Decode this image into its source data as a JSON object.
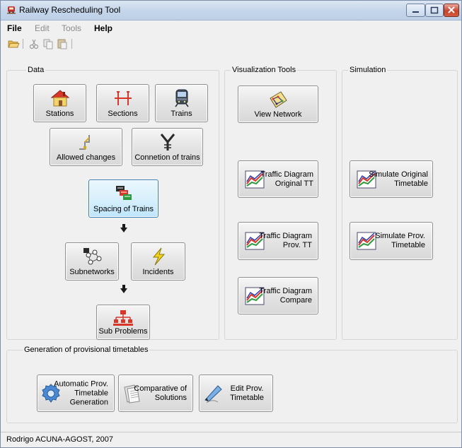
{
  "window": {
    "title": "Railway Rescheduling Tool"
  },
  "menu": {
    "file": "File",
    "edit": "Edit",
    "tools": "Tools",
    "help": "Help"
  },
  "groups": {
    "data": "Data",
    "visualization": "Visualization Tools",
    "simulation": "Simulation",
    "generation": "Generation of provisional timetables"
  },
  "buttons": {
    "stations": "Stations",
    "sections": "Sections",
    "trains": "Trains",
    "allowed_changes": "Allowed changes",
    "connection_of_trains": "Connetion of trains",
    "spacing_of_trains": "Spacing of Trains",
    "subnetworks": "Subnetworks",
    "incidents": "Incidents",
    "sub_problems": "Sub Problems",
    "view_network": "View Network",
    "traffic_original": [
      "Traffic Diagram",
      "Original TT"
    ],
    "traffic_prov": [
      "Traffic Diagram",
      "Prov. TT"
    ],
    "traffic_compare": [
      "Traffic Diagram",
      "Compare"
    ],
    "simulate_original": [
      "Simulate Original",
      "Timetable"
    ],
    "simulate_prov": [
      "Simulate Prov.",
      "Timetable"
    ],
    "automatic_prov": [
      "Automatic Prov.",
      "Timetable",
      "Generation"
    ],
    "comparative": [
      "Comparative of",
      "Solutions"
    ],
    "edit_prov": [
      "Edit Prov.",
      "Timetable"
    ]
  },
  "status": {
    "text": "Rodrigo ACUNA-AGOST, 2007"
  },
  "icons": {
    "app": "train-icon",
    "open": "folder-open-icon",
    "cut": "cut-icon",
    "copy": "copy-icon",
    "paste": "paste-icon"
  }
}
